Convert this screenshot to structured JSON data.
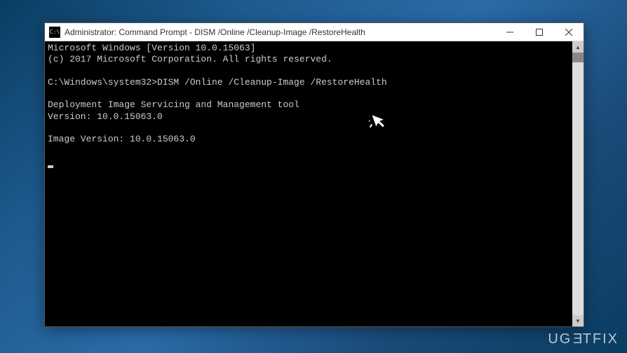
{
  "window": {
    "title": "Administrator: Command Prompt - DISM  /Online /Cleanup-Image /RestoreHealth",
    "icon_label": "C:\\"
  },
  "terminal": {
    "line1": "Microsoft Windows [Version 10.0.15063]",
    "line2": "(c) 2017 Microsoft Corporation. All rights reserved.",
    "blank1": "",
    "prompt_line": "C:\\Windows\\system32>DISM /Online /Cleanup-Image /RestoreHealth",
    "blank2": "",
    "tool_line": "Deployment Image Servicing and Management tool",
    "version_line": "Version: 10.0.15063.0",
    "blank3": "",
    "image_version_line": "Image Version: 10.0.15063.0",
    "blank4": ""
  },
  "watermark": {
    "pre": "UG",
    "flipped": "E",
    "post": "TFIX"
  }
}
